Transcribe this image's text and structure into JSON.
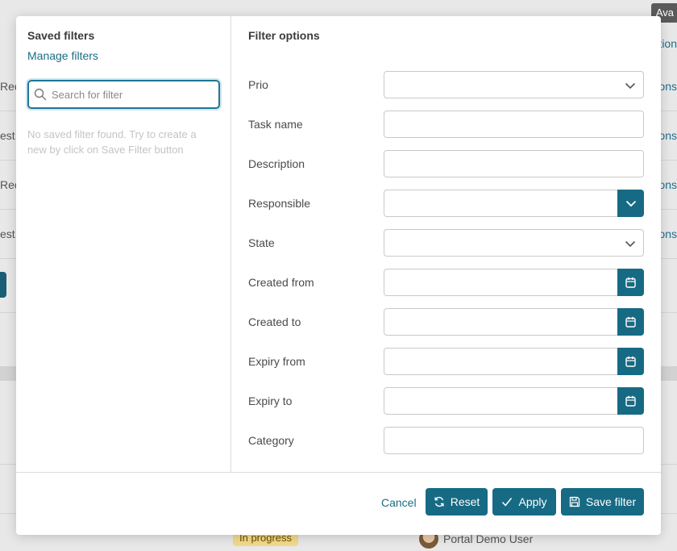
{
  "background": {
    "tooltip": "Ava",
    "row_left_texts": [
      "Rec",
      "est D",
      "Rec",
      "est D"
    ],
    "row_right_texts": [
      "ons",
      "ons",
      "ons",
      "ons"
    ],
    "header_right": "ption",
    "status_badge": "In progress",
    "user_name": "Portal Demo User"
  },
  "saved_filters": {
    "title": "Saved filters",
    "manage_label": "Manage filters",
    "search_placeholder": "Search for filter",
    "search_value": "",
    "empty_message": "No saved filter found. Try to create a new by click on Save Filter button"
  },
  "filter_options": {
    "title": "Filter options",
    "fields": [
      {
        "label": "Prio",
        "type": "select",
        "value": ""
      },
      {
        "label": "Task name",
        "type": "text",
        "value": ""
      },
      {
        "label": "Description",
        "type": "text",
        "value": ""
      },
      {
        "label": "Responsible",
        "type": "select-button",
        "value": ""
      },
      {
        "label": "State",
        "type": "select",
        "value": ""
      },
      {
        "label": "Created from",
        "type": "date",
        "value": ""
      },
      {
        "label": "Created to",
        "type": "date",
        "value": ""
      },
      {
        "label": "Expiry from",
        "type": "date",
        "value": ""
      },
      {
        "label": "Expiry to",
        "type": "date",
        "value": ""
      },
      {
        "label": "Category",
        "type": "text",
        "value": ""
      }
    ]
  },
  "footer": {
    "cancel_label": "Cancel",
    "reset_label": "Reset",
    "apply_label": "Apply",
    "save_label": "Save filter"
  },
  "colors": {
    "accent": "#176a83",
    "link": "#1a6d86",
    "focus_border": "#1f7696",
    "badge_bg": "#f3d98a"
  }
}
